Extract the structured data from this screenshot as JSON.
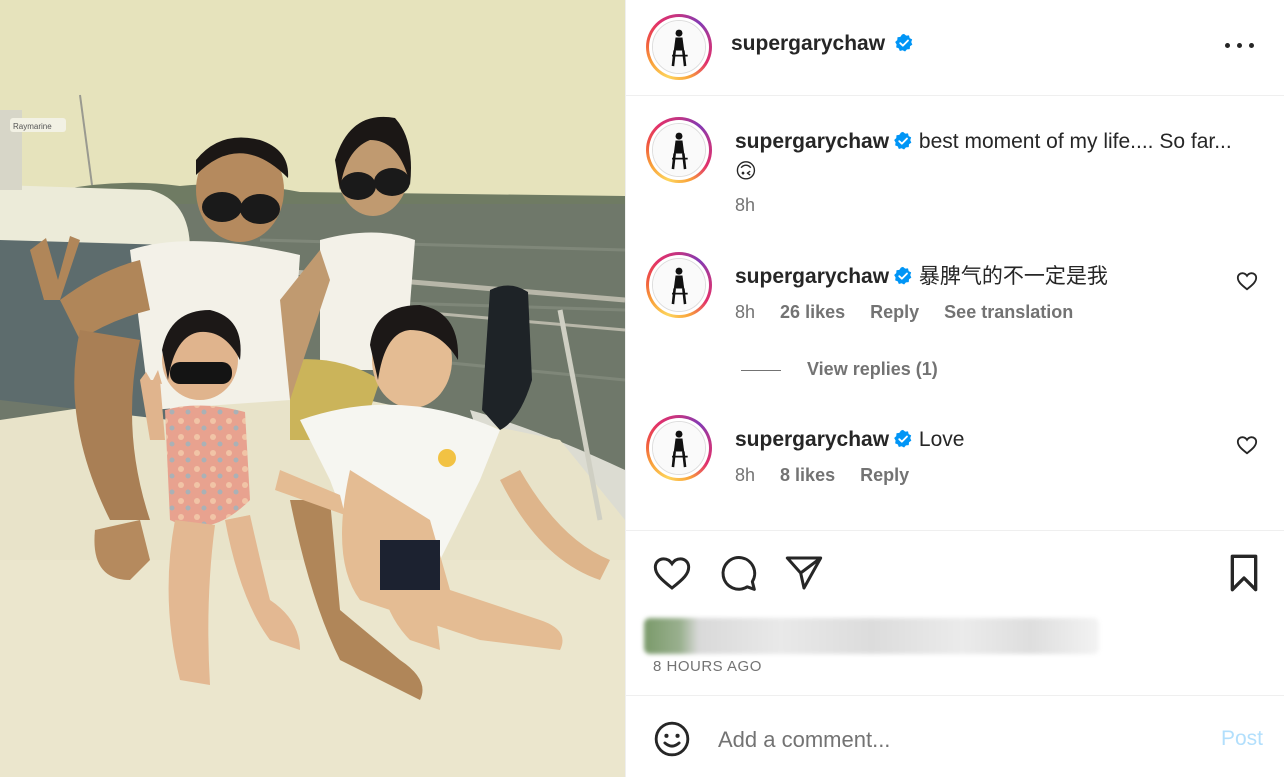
{
  "post": {
    "username": "supergarychaw",
    "verified": true,
    "more_icon": "more-horizontal-icon"
  },
  "caption": {
    "username": "supergarychaw",
    "text": "best moment of my life.... So far...",
    "emoji": "🙃",
    "time": "8h"
  },
  "comments": [
    {
      "username": "supergarychaw",
      "text": "暴脾气的不一定是我",
      "time": "8h",
      "likes": "26 likes",
      "reply": "Reply",
      "translate": "See translation",
      "view_replies": "View replies (1)"
    },
    {
      "username": "supergarychaw",
      "text": "Love",
      "time": "8h",
      "likes": "8 likes",
      "reply": "Reply"
    }
  ],
  "actions": {
    "like_icon": "heart-icon",
    "comment_icon": "comment-icon",
    "share_icon": "send-icon",
    "save_icon": "bookmark-icon",
    "time_ago": "8 HOURS AGO"
  },
  "add_comment": {
    "placeholder": "Add a comment...",
    "post_label": "Post",
    "emoji_icon": "smiley-icon"
  },
  "photo": {
    "boat_brand": "Raymarine"
  },
  "colors": {
    "verified_blue": "#0095f6",
    "post_disabled": "#b2dffc",
    "muted_text": "#737373"
  }
}
